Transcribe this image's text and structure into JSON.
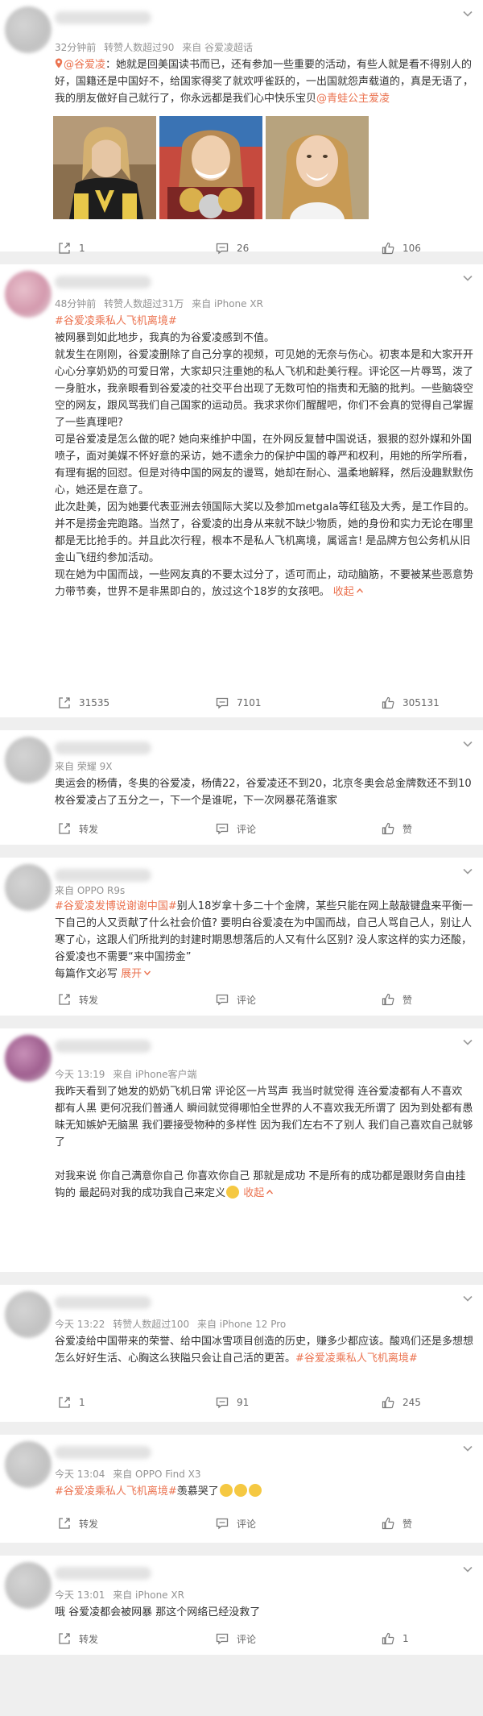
{
  "posts": [
    {
      "meta_time": "32分钟前",
      "meta_reposts": "转赞人数超过90",
      "meta_source": "来自 谷爱凌超话",
      "mention_prefix": "@谷爱凌",
      "text": "：她就是回美国读书而已，还有参加一些重要的活动，有些人就是看不得别人的好，国籍还是中国好不，给国家得奖了就欢呼雀跃的，一出国就怨声载道的，真是无语了，我的朋友做好自己就行了，你永远都是我们心中快乐宝贝",
      "mention_suffix": "@青蛙公主爱凌",
      "repost_count": "1",
      "comment_count": "26",
      "like_count": "106"
    },
    {
      "meta_time": "48分钟前",
      "meta_reposts": "转赞人数超过31万",
      "meta_source": "来自 iPhone XR",
      "topic": "#谷爱凌乘私人飞机离境#",
      "paragraphs": [
        "被网暴到如此地步，我真的为谷爱凌感到不值。",
        "就发生在刚刚，谷爱凌删除了自己分享的视频，可见她的无奈与伤心。初衷本是和大家开开心心分享奶奶的可爱日常，大家却只注重她的私人飞机和赴美行程。评论区一片辱骂，泼了一身脏水，我亲眼看到谷爱凌的社交平台出现了无数可怕的指责和无脑的批判。一些脑袋空空的网友，跟风骂我们自己国家的运动员。我求求你们醒醒吧，你们不会真的觉得自己掌握了一些真理吧?",
        "可是谷爱凌是怎么做的呢? 她向来维护中国，在外网反复替中国说话，狠狠的怼外媒和外国喷子，面对美媒不怀好意的采访，她不遗余力的保护中国的尊严和权利，用她的所学所看，有理有据的回怼。但是对待中国的网友的谩骂，她却在耐心、温柔地解释，然后没趣默默伤心，她还是在意了。",
        "此次赴美，因为她要代表亚洲去领国际大奖以及参加metgala等红毯及大秀，是工作目的。并不是捞金完跑路。当然了，谷爱凌的出身从来就不缺少物质，她的身份和实力无论在哪里都是无比抢手的。并且此次行程，根本不是私人飞机离境，属谣言! 是品牌方包公务机从旧金山飞纽约参加活动。",
        "现在她为中国而战，一些网友真的不要太过分了，适可而止，动动脑筋，不要被某些恶意势力带节奏，世界不是非黑即白的，放过这个18岁的女孩吧。"
      ],
      "collapse_label": "收起",
      "repost_count": "31535",
      "comment_count": "7101",
      "like_count": "305131"
    },
    {
      "meta_source": "来自 荣耀 9X",
      "text": "奥运会的杨倩，冬奥的谷爱凌，杨倩22，谷爱凌还不到20，北京冬奥会总金牌数还不到10枚谷爱凌占了五分之一，下一个是谁呢，下一次网暴花落谁家",
      "repost_label": "转发",
      "comment_label": "评论",
      "like_label": "赞"
    },
    {
      "meta_source": "来自 OPPO R9s",
      "topic": "#谷爱凌发博说谢谢中国#",
      "text": "别人18岁拿十多二十个金牌，某些只能在网上敲敲键盘来平衡一下自己的人又贡献了什么社会价值? 要明白谷爱凌在为中国而战，自己人骂自己人，别让人寒了心，这跟人们所批判的封建时期思想落后的人又有什么区别? 没人家这样的实力还酸，谷爱凌也不需要“来中国捞金”",
      "text2": "每篇作文必写",
      "expand_label": "展开",
      "repost_label": "转发",
      "comment_label": "评论",
      "like_label": "赞"
    },
    {
      "meta_time": "今天 13:19",
      "meta_source": "来自 iPhone客户端",
      "paragraph1": "我昨天看到了她发的奶奶飞机日常 评论区一片骂声 我当时就觉得 连谷爱凌都有人不喜欢 都有人黑 更何况我们普通人 瞬间就觉得哪怕全世界的人不喜欢我无所谓了 因为到处都有愚昧无知嫉妒无脑黑 我们要接受物种的多样性 因为我们左右不了别人 我们自己喜欢自己就够了",
      "paragraph2": "对我来说 你自己满意你自己 你喜欢你自己 那就是成功 不是所有的成功都是跟财务自由挂钩的 最起码对我的成功我自己来定义",
      "collapse_label": "收起"
    },
    {
      "meta_time": "今天 13:22",
      "meta_reposts": "转赞人数超过100",
      "meta_source": "来自 iPhone 12 Pro",
      "text": "谷爱凌给中国带来的荣誉、给中国冰雪项目创造的历史，赚多少都应该。酸鸡们还是多想想怎么好好生活、心胸这么狭隘只会让自己活的更苦。",
      "topic": "#谷爱凌乘私人飞机离境#",
      "repost_count": "1",
      "comment_count": "91",
      "like_count": "245"
    },
    {
      "meta_time": "今天 13:04",
      "meta_source": "来自 OPPO Find X3",
      "topic": "#谷爱凌乘私人飞机离境#",
      "text": "羡慕哭了",
      "repost_label": "转发",
      "comment_label": "评论",
      "like_label": "赞"
    },
    {
      "meta_time": "今天 13:01",
      "meta_source": "来自 iPhone XR",
      "text": "哦 谷爱凌都会被网暴 那这个网络已经没救了",
      "repost_label": "转发",
      "comment_label": "评论",
      "like_count": "1"
    }
  ],
  "icons": {
    "repost": "repost-icon",
    "comment": "comment-icon",
    "like": "like-icon",
    "chevron": "chevron-down-icon",
    "location": "location-pin-icon"
  },
  "colors": {
    "accent": "#eb7350",
    "meta": "#939393",
    "text": "#333333",
    "background": "#efefef"
  }
}
